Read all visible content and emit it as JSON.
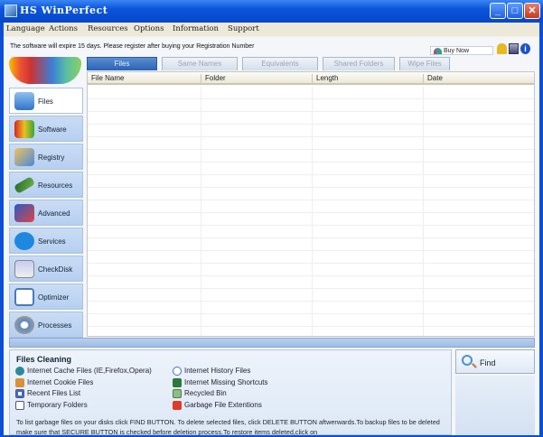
{
  "window": {
    "title": "HS WinPerfect",
    "controls": [
      "minimize",
      "maximize",
      "close"
    ]
  },
  "menu": [
    "Language",
    "Actions",
    "Resources",
    "Options",
    "Information",
    "Support"
  ],
  "notice": "The software will expire 15 days. Please register after buying your Registration Number",
  "buy_now": "Buy Now",
  "toolbar_icons": [
    "lock-icon",
    "save-icon",
    "info-icon"
  ],
  "tabs": [
    {
      "label": "Files",
      "active": true
    },
    {
      "label": "Same Names"
    },
    {
      "label": "Equivalents"
    },
    {
      "label": "Shared Folders"
    },
    {
      "label": "Wipe Files"
    }
  ],
  "columns": [
    "File Name",
    "Folder",
    "Length",
    "Date"
  ],
  "sidebar": [
    {
      "label": "Files",
      "icon": "folder-icon",
      "active": true
    },
    {
      "label": "Software",
      "icon": "cubes-icon"
    },
    {
      "label": "Registry",
      "icon": "registry-icon"
    },
    {
      "label": "Resources",
      "icon": "memory-icon"
    },
    {
      "label": "Advanced",
      "icon": "computer-tools-icon"
    },
    {
      "label": "Services",
      "icon": "services-gear-icon"
    },
    {
      "label": "CheckDisk",
      "icon": "disk-icon"
    },
    {
      "label": "Optimizer",
      "icon": "magnifier-icon"
    },
    {
      "label": "Processes",
      "icon": "gears-icon"
    }
  ],
  "cleaning": {
    "title": "Files Cleaning",
    "left": [
      "Internet Cache Files (IE,Firefox,Opera)",
      "Internet Cookie Files",
      "Recent Files List",
      "Temporary Folders"
    ],
    "right": [
      "Internet History Files",
      "Internet Missing Shortcuts",
      "Recycled Bin",
      "Garbage File Extentions"
    ],
    "help": "To list garbage files on your disks click FIND BUTTON. To delete selected files, click DELETE BUTTON aftwerwards.To backup files to be deleted make sure that SECURE BUTTON is checked before deletion process.To restore items deleted,click on"
  },
  "find_label": "Find"
}
